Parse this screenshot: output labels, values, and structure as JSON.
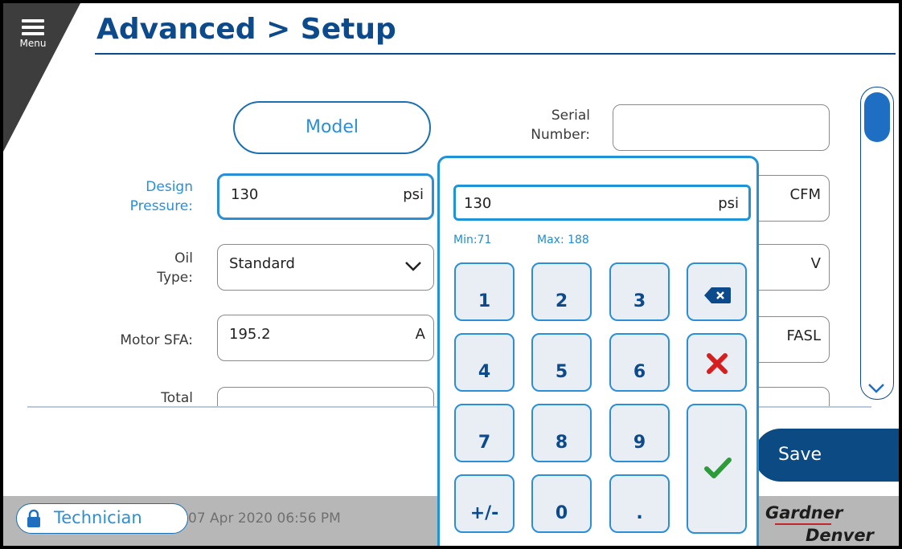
{
  "header": {
    "menu_label": "Menu",
    "title": "Advanced > Setup"
  },
  "form": {
    "model_button": "Model",
    "serial_label_1": "Serial",
    "serial_label_2": "Number:",
    "serial_value": "",
    "design_label_1": "Design",
    "design_label_2": "Pressure:",
    "design_value": "130",
    "design_unit": "psi",
    "oil_label_1": "Oil",
    "oil_label_2": "Type:",
    "oil_value": "Standard",
    "motor_label": "Motor SFA:",
    "motor_value": "195.2",
    "motor_unit": "A",
    "total_label": "Total",
    "right_unit_1": "CFM",
    "right_unit_2": "V",
    "right_unit_3": "FASL"
  },
  "keypad": {
    "value": "130",
    "unit": "psi",
    "min": "Min:71",
    "max": "Max:  188",
    "keys": [
      "1",
      "2",
      "3",
      "4",
      "5",
      "6",
      "7",
      "8",
      "9",
      "+/-",
      "0",
      "."
    ]
  },
  "actions": {
    "save": "Save"
  },
  "footer": {
    "user_role": "Technician",
    "datetime": "07 Apr 2020  06:56 PM",
    "brand_1": "Gardner",
    "brand_2": "Denver"
  },
  "colors": {
    "accent": "#2a8fd6",
    "brand": "#0d4a8c",
    "cancel": "#d61f1f",
    "confirm": "#2e9b3a"
  }
}
